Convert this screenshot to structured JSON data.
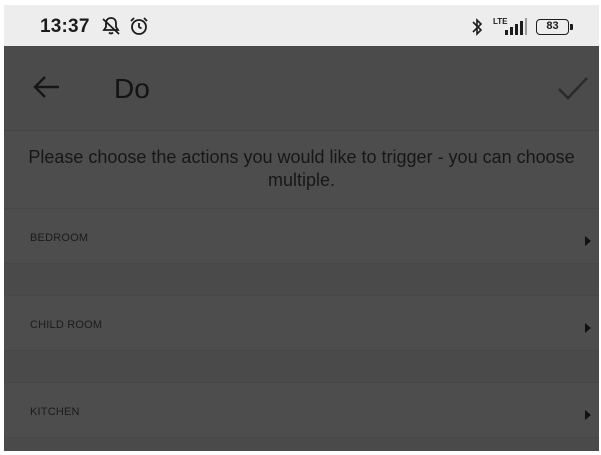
{
  "statusbar": {
    "time": "13:37",
    "network": "LTE",
    "battery": "83",
    "icons": [
      "muted-notifications-icon",
      "alarm-icon",
      "bluetooth-icon",
      "signal-icon",
      "battery-icon"
    ]
  },
  "appbar": {
    "title": "Do",
    "back_icon": "arrow-left-icon",
    "confirm_icon": "check-icon"
  },
  "intro_text": "Please choose the actions you would like to trigger - you can choose multiple.",
  "rooms": [
    {
      "label": "BEDROOM"
    },
    {
      "label": "CHILD ROOM"
    },
    {
      "label": "KITCHEN"
    }
  ]
}
